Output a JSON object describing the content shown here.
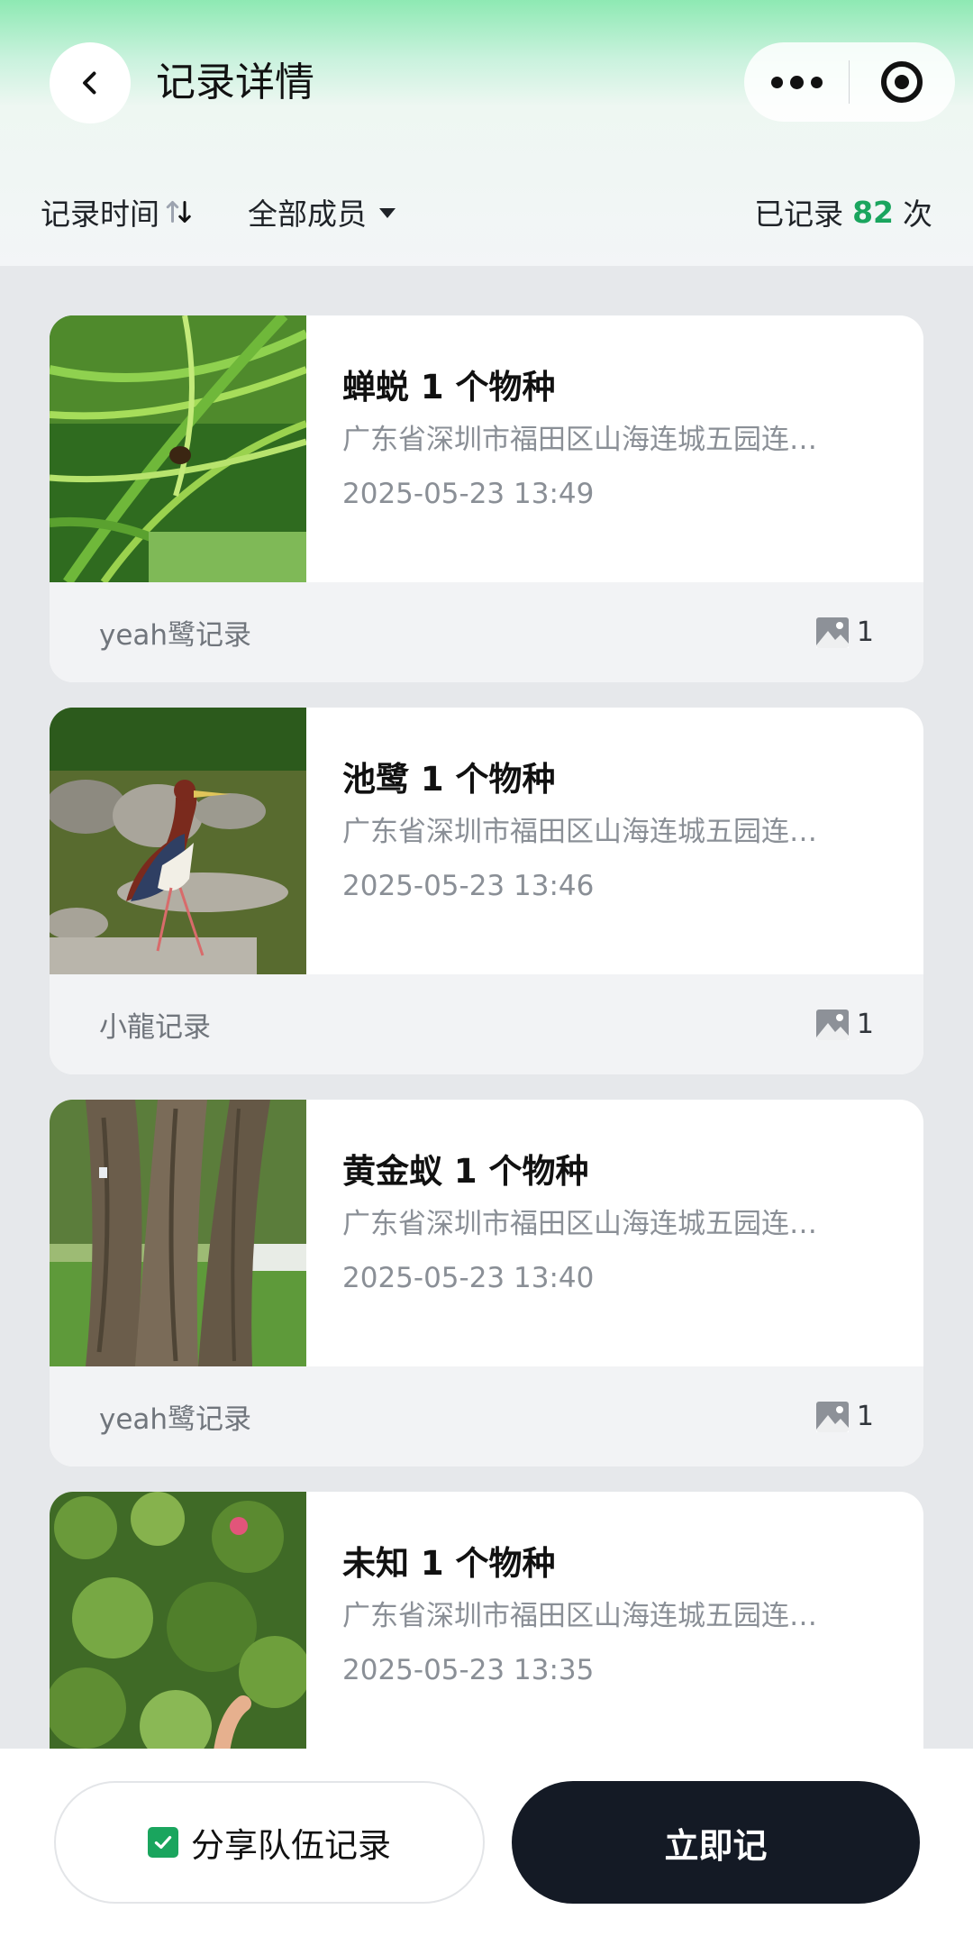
{
  "header": {
    "title": "记录详情"
  },
  "filter": {
    "sort_label": "记录时间",
    "member_label": "全部成员",
    "count_prefix": "已记录",
    "count_value": "82",
    "count_suffix": "次"
  },
  "records": [
    {
      "species": "蝉蜕 1 个物种",
      "address": "广东省深圳市福田区山海连城五园连…",
      "time": "2025-05-23 13:49",
      "author": "yeah鹭记录",
      "photo_count": "1"
    },
    {
      "species": "池鹭 1 个物种",
      "address": "广东省深圳市福田区山海连城五园连…",
      "time": "2025-05-23 13:46",
      "author": "小龍记录",
      "photo_count": "1"
    },
    {
      "species": "黄金蚁 1 个物种",
      "address": "广东省深圳市福田区山海连城五园连…",
      "time": "2025-05-23 13:40",
      "author": "yeah鹭记录",
      "photo_count": "1"
    },
    {
      "species": "未知 1 个物种",
      "address": "广东省深圳市福田区山海连城五园连…",
      "time": "2025-05-23 13:35"
    }
  ],
  "bottom": {
    "share_label": "分享队伍记录",
    "record_label": "立即记"
  },
  "colors": {
    "accent_green": "#1aa55e",
    "primary_dark": "#141a25"
  }
}
